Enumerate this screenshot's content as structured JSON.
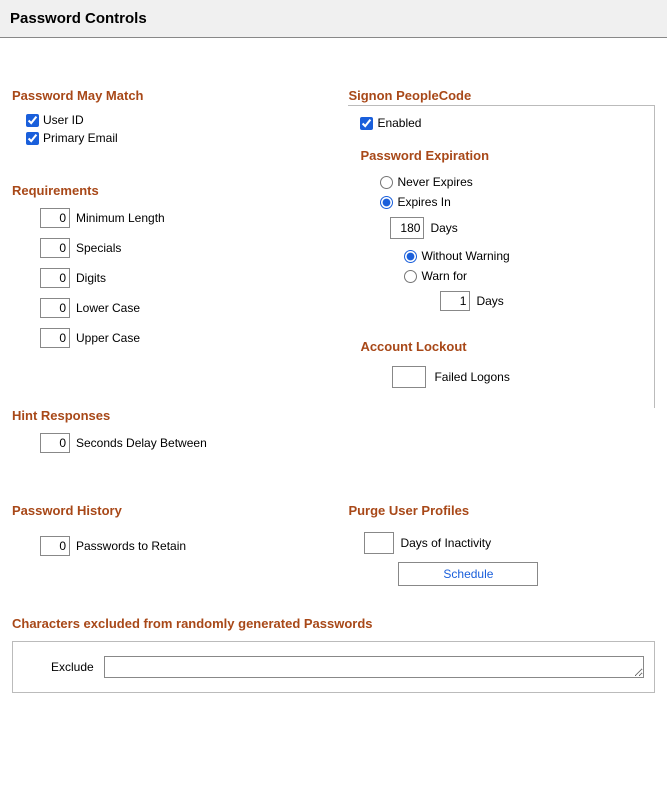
{
  "page_title": "Password Controls",
  "password_may_match": {
    "title": "Password May Match",
    "user_id_label": "User ID",
    "user_id_checked": true,
    "primary_email_label": "Primary Email",
    "primary_email_checked": true
  },
  "requirements": {
    "title": "Requirements",
    "min_length_label": "Minimum Length",
    "min_length_value": "0",
    "specials_label": "Specials",
    "specials_value": "0",
    "digits_label": "Digits",
    "digits_value": "0",
    "lower_label": "Lower Case",
    "lower_value": "0",
    "upper_label": "Upper Case",
    "upper_value": "0"
  },
  "hint_responses": {
    "title": "Hint Responses",
    "seconds_label": "Seconds Delay Between",
    "seconds_value": "0"
  },
  "password_history": {
    "title": "Password History",
    "retain_label": "Passwords to Retain",
    "retain_value": "0"
  },
  "signon": {
    "title": "Signon PeopleCode",
    "enabled_label": "Enabled",
    "enabled_checked": true,
    "password_expiration": {
      "title": "Password Expiration",
      "never_label": "Never Expires",
      "expires_in_label": "Expires In",
      "expires_selected": "expires_in",
      "days_value": "180",
      "days_label": "Days",
      "without_warning_label": "Without Warning",
      "warn_for_label": "Warn for",
      "warning_selected": "without_warning",
      "warn_days_value": "1",
      "warn_days_label": "Days"
    },
    "account_lockout": {
      "title": "Account Lockout",
      "failed_logons_label": "Failed Logons",
      "failed_value": ""
    }
  },
  "purge": {
    "title": "Purge User Profiles",
    "days_label": "Days of Inactivity",
    "days_value": "",
    "schedule_label": "Schedule"
  },
  "exclude": {
    "title": "Characters excluded from randomly generated Passwords",
    "label": "Exclude",
    "value": ""
  }
}
